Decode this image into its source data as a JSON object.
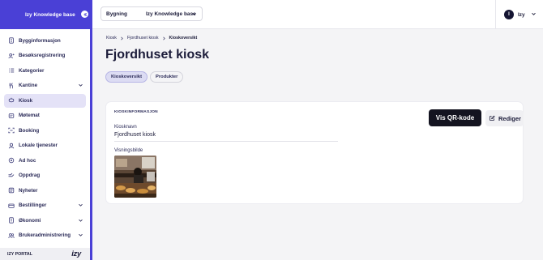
{
  "sidebar": {
    "brand": "Izy Knowledge base",
    "items": [
      {
        "label": "Bygginformasjon",
        "icon": "building-icon",
        "active": false,
        "expandable": false
      },
      {
        "label": "Besøksregistrering",
        "icon": "visitor-icon",
        "active": false,
        "expandable": false
      },
      {
        "label": "Kategorier",
        "icon": "list-icon",
        "active": false,
        "expandable": false
      },
      {
        "label": "Kantine",
        "icon": "cutlery-icon",
        "active": false,
        "expandable": true
      },
      {
        "label": "Kiosk",
        "icon": "kiosk-icon",
        "active": true,
        "expandable": false
      },
      {
        "label": "Møtemat",
        "icon": "meeting-food-icon",
        "active": false,
        "expandable": false
      },
      {
        "label": "Booking",
        "icon": "booking-icon",
        "active": false,
        "expandable": false
      },
      {
        "label": "Lokale tjenester",
        "icon": "local-services-icon",
        "active": false,
        "expandable": false
      },
      {
        "label": "Ad hoc",
        "icon": "adhoc-icon",
        "active": false,
        "expandable": false
      },
      {
        "label": "Oppdrag",
        "icon": "task-icon",
        "active": false,
        "expandable": false
      },
      {
        "label": "Nyheter",
        "icon": "news-icon",
        "active": false,
        "expandable": false
      },
      {
        "label": "Bestillinger",
        "icon": "orders-icon",
        "active": false,
        "expandable": true
      },
      {
        "label": "Økonomi",
        "icon": "finance-icon",
        "active": false,
        "expandable": true
      },
      {
        "label": "Brukeradministrering",
        "icon": "users-icon",
        "active": false,
        "expandable": true
      }
    ],
    "footer": {
      "portal": "IZY PORTAL",
      "logo": "izy"
    }
  },
  "topbar": {
    "building_label": "Bygning",
    "building_value": "Izy Knowledge base",
    "user_initial": "I",
    "user_name": "Izy"
  },
  "breadcrumb": [
    "Kiosk",
    "Fjordhuset kiosk",
    "Kioskoversikt"
  ],
  "page_title": "Fjordhuset kiosk",
  "tabs": [
    {
      "label": "Kioskoversikt",
      "active": true
    },
    {
      "label": "Produkter",
      "active": false
    }
  ],
  "card": {
    "section_title": "KIOSKINFORMASJON",
    "qr_button": "Vis QR-kode",
    "edit_button": "Rediger",
    "name_label": "Kiosknavn",
    "name_value": "Fjordhuset kiosk",
    "image_label": "Visningsbilde"
  },
  "colors": {
    "accent": "#4a40d6",
    "active_bg": "#e4e2f7",
    "dark_button": "#141420"
  }
}
